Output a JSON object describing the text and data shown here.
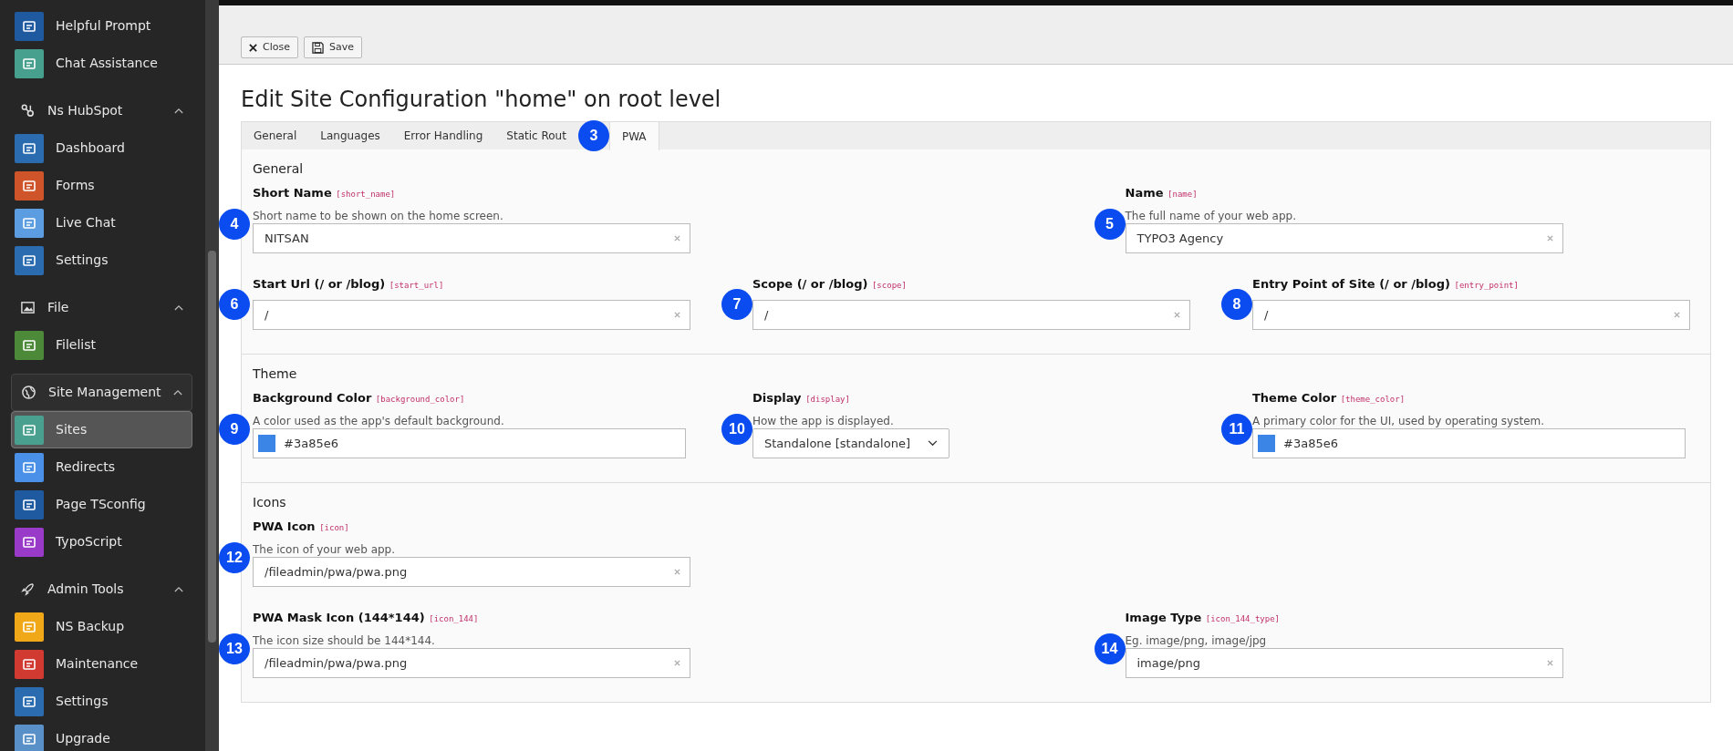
{
  "sidebar": {
    "groups": [
      {
        "items": [
          {
            "label": "Helpful Prompt",
            "color": "#1f5aa0",
            "selected": false
          },
          {
            "label": "Chat Assistance",
            "color": "#47a08e",
            "selected": false
          }
        ]
      },
      {
        "title": "Ns HubSpot",
        "expanded": true,
        "items": [
          {
            "label": "Dashboard",
            "color": "#2b6cb0",
            "selected": false
          },
          {
            "label": "Forms",
            "color": "#d0542a",
            "selected": false
          },
          {
            "label": "Live Chat",
            "color": "#5b9de0",
            "selected": false
          },
          {
            "label": "Settings",
            "color": "#2b6cb0",
            "selected": false
          }
        ]
      },
      {
        "title": "File",
        "expanded": true,
        "items": [
          {
            "label": "Filelist",
            "color": "#4c8a3a",
            "selected": false
          }
        ]
      },
      {
        "title": "Site Management",
        "expanded": true,
        "items": [
          {
            "label": "Sites",
            "color": "#4aa08f",
            "selected": true
          },
          {
            "label": "Redirects",
            "color": "#4a90e8",
            "selected": false
          },
          {
            "label": "Page TSconfig",
            "color": "#1f5aa0",
            "selected": false
          },
          {
            "label": "TypoScript",
            "color": "#9a3ac8",
            "selected": false
          }
        ]
      },
      {
        "title": "Admin Tools",
        "expanded": true,
        "items": [
          {
            "label": "NS Backup",
            "color": "#f0a818",
            "selected": false
          },
          {
            "label": "Maintenance",
            "color": "#d03a30",
            "selected": false
          },
          {
            "label": "Settings",
            "color": "#2b6cb0",
            "selected": false
          },
          {
            "label": "Upgrade",
            "color": "#5a90c8",
            "selected": false
          }
        ]
      }
    ]
  },
  "toolbar": {
    "buttons": [
      {
        "label": "Close",
        "kind": "close"
      },
      {
        "label": "Save",
        "kind": "save"
      }
    ]
  },
  "title": "Edit Site Configuration \"home\" on root level",
  "tabs": [
    {
      "label": "General",
      "selected": false
    },
    {
      "label": "Languages",
      "selected": false
    },
    {
      "label": "Error Handling",
      "selected": false
    },
    {
      "label": "Static Rout",
      "selected": false
    },
    {
      "label": "PWA",
      "selected": true,
      "marker": "3"
    }
  ],
  "sections": [
    {
      "heading": "General",
      "rows": [
        {
          "fields": [
            {
              "label": "Short Name",
              "key": "[short_name]",
              "help": "Short name to be shown on the home screen.",
              "kind": "text",
              "value": "NITSAN",
              "marker": "4"
            },
            {
              "label": "Name",
              "key": "[name]",
              "help": "The full name of your web app.",
              "kind": "text",
              "value": "TYPO3 Agency",
              "marker": "5"
            }
          ]
        },
        {
          "fields": [
            {
              "label": "Start Url (/ or /blog)",
              "key": "[start_url]",
              "kind": "text",
              "value": "/",
              "marker": "6"
            },
            {
              "label": "Scope (/ or /blog)",
              "key": "[scope]",
              "kind": "text",
              "value": "/",
              "marker": "7"
            },
            {
              "label": "Entry Point of Site (/ or /blog)",
              "key": "[entry_point]",
              "kind": "text",
              "value": "/",
              "marker": "8"
            }
          ]
        }
      ]
    },
    {
      "heading": "Theme",
      "rows": [
        {
          "fields": [
            {
              "label": "Background Color",
              "key": "[background_color]",
              "help": "A color used as the app's default background.",
              "kind": "color",
              "value": "#3a85e6",
              "color": "#3a85e6",
              "marker": "9"
            },
            {
              "label": "Display",
              "key": "[display]",
              "help": "How the app is displayed.",
              "kind": "select",
              "value": "Standalone [standalone]",
              "marker": "10"
            },
            {
              "label": "Theme Color",
              "key": "[theme_color]",
              "help": "A primary color for the UI, used by operating system.",
              "kind": "color",
              "value": "#3a85e6",
              "color": "#3a85e6",
              "marker": "11"
            }
          ]
        }
      ]
    },
    {
      "heading": "Icons",
      "rows": [
        {
          "fields": [
            {
              "label": "PWA Icon",
              "key": "[icon]",
              "help": "The icon of your web app.",
              "kind": "text",
              "value": "/fileadmin/pwa/pwa.png",
              "marker": "12"
            }
          ]
        },
        {
          "fields": [
            {
              "label": "PWA Mask Icon (144*144)",
              "key": "[icon_144]",
              "help": "The icon size should be 144*144.",
              "kind": "text",
              "value": "/fileadmin/pwa/pwa.png",
              "marker": "13"
            },
            {
              "label": "Image Type",
              "key": "[icon_144_type]",
              "help": "Eg. image/png, image/jpg",
              "kind": "text",
              "value": "image/png",
              "marker": "14"
            }
          ]
        }
      ]
    }
  ]
}
